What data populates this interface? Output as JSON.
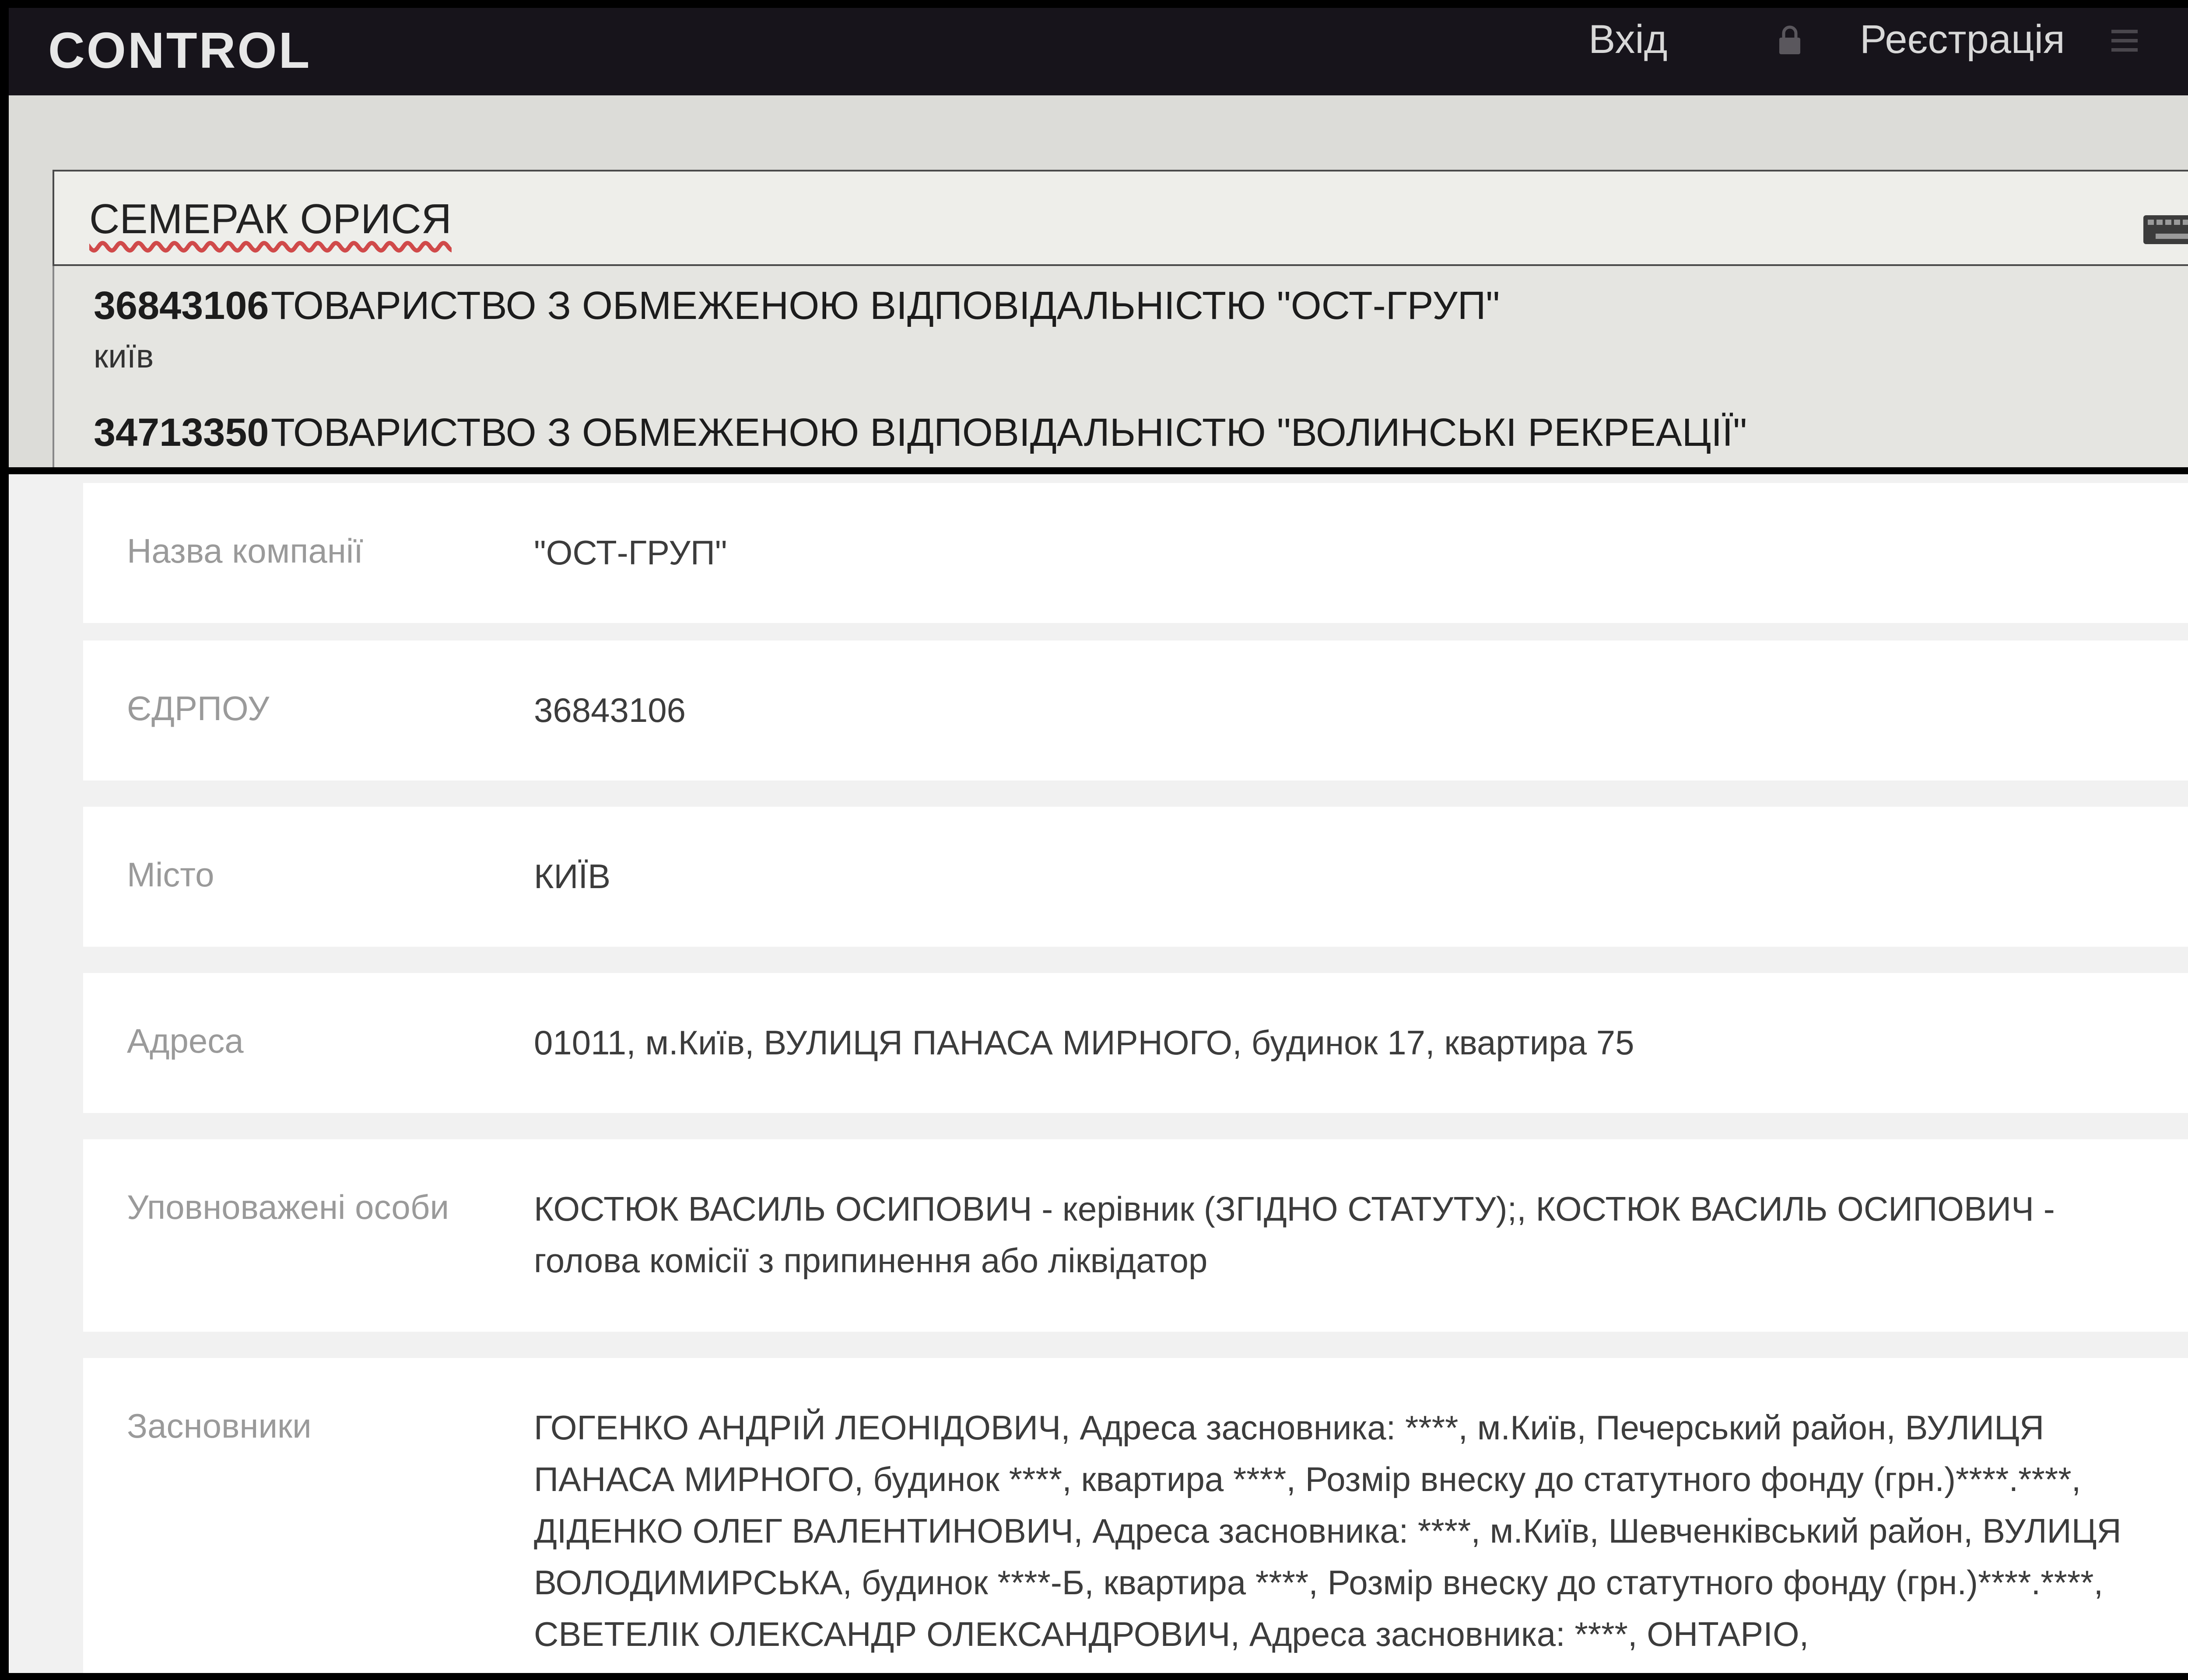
{
  "navbar": {
    "logo": "CONTROL",
    "login_label": "Вхід",
    "register_label": "Реєстрація",
    "icons": [
      "lock-icon",
      "menu-icon",
      "phone-icon",
      "keyboard-icon"
    ]
  },
  "search": {
    "value": "СЕМЕРАК ОРИСЯ"
  },
  "results": [
    {
      "code": "36843106",
      "name": "ТОВАРИСТВО З ОБМЕЖЕНОЮ ВІДПОВІДАЛЬНІСТЮ \"ОСТ-ГРУП\"",
      "city": "київ"
    },
    {
      "code": "34713350",
      "name": "ТОВАРИСТВО З ОБМЕЖЕНОЮ ВІДПОВІДАЛЬНІСТЮ \"ВОЛИНСЬКІ РЕКРЕАЦІЇ\""
    }
  ],
  "details": [
    {
      "label": "Назва компанії",
      "value": "\"ОСТ-ГРУП\""
    },
    {
      "label": "ЄДРПОУ",
      "value": "36843106"
    },
    {
      "label": "Місто",
      "value": "КИЇВ"
    },
    {
      "label": "Адреса",
      "value": "01011, м.Київ, ВУЛИЦЯ ПАНАСА МИРНОГО, будинок 17, квартира 75"
    },
    {
      "label": "Уповноважені особи",
      "value": "КОСТЮК ВАСИЛЬ ОСИПОВИЧ - керівник (ЗГІДНО СТАТУТУ);, КОСТЮК ВАСИЛЬ ОСИПОВИЧ - голова комісії з припинення або ліквідатор"
    },
    {
      "label": "Засновники",
      "value": "ГОГЕНКО АНДРІЙ ЛЕОНІДОВИЧ, Адреса засновника: ****, м.Київ, Печерський район, ВУЛИЦЯ ПАНАСА МИРНОГО, будинок ****, квартира ****, Розмір внеску до статутного фонду (грн.)****.****, ДІДЕНКО ОЛЕГ ВАЛЕНТИНОВИЧ, Адреса засновника: ****, м.Київ, Шевченківський район, ВУЛИЦЯ ВОЛОДИМИРСЬКА, будинок ****-Б, квартира ****, Розмір внеску до статутного фонду (грн.)****.****, СВЕТЕЛІК ОЛЕКСАНДР ОЛЕКСАНДРОВИЧ, Адреса засновника: ****, ОНТАРІО,"
    }
  ]
}
